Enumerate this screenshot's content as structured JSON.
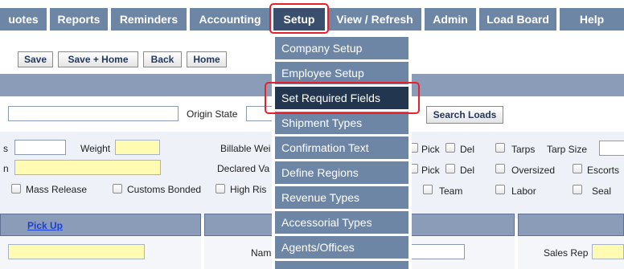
{
  "nav": {
    "items": [
      {
        "label": "uotes"
      },
      {
        "label": "Reports"
      },
      {
        "label": "Reminders"
      },
      {
        "label": "Accounting"
      },
      {
        "label": "Setup"
      },
      {
        "label": "View / Refresh"
      },
      {
        "label": "Admin"
      },
      {
        "label": "Load Board"
      },
      {
        "label": "Help"
      }
    ]
  },
  "toolbar": {
    "save": "Save",
    "save_home": "Save + Home",
    "back": "Back",
    "home": "Home"
  },
  "search": {
    "origin_state_label": "Origin State",
    "search_loads": "Search Loads"
  },
  "form": {
    "s_label": "s",
    "weight_label": "Weight",
    "n_label": "n",
    "billable_weight_label": "Billable Wei",
    "declared_value_label": "Declared Va",
    "mass_release": "Mass Release",
    "customs_bonded": "Customs Bonded",
    "high_risk": "High Ris",
    "pick1": "Pick",
    "del1": "Del",
    "pick2": "Pick",
    "del2": "Del",
    "tarps": "Tarps",
    "tarp_size": "Tarp Size",
    "oversized": "Oversized",
    "escorts": "Escorts",
    "team": "Team",
    "labor": "Labor",
    "seal": "Seal"
  },
  "sections": {
    "pick_up": "Pick Up",
    "name_label": "Nam",
    "sales_rep_label": "Sales Rep"
  },
  "dropdown": {
    "items": [
      {
        "label": "Company Setup"
      },
      {
        "label": "Employee Setup"
      },
      {
        "label": "Set Required Fields"
      },
      {
        "label": "Shipment Types"
      },
      {
        "label": "Confirmation Text"
      },
      {
        "label": "Define Regions"
      },
      {
        "label": "Revenue Types"
      },
      {
        "label": "Accessorial Types"
      },
      {
        "label": "Agents/Offices"
      }
    ]
  },
  "colors": {
    "nav_bg": "#6e86a6",
    "nav_active": "#3a4e6e",
    "dropdown_highlight": "#22364f",
    "highlight_box": "#e8202a",
    "required_field": "#fffbb3",
    "link": "#1a3fd6"
  }
}
